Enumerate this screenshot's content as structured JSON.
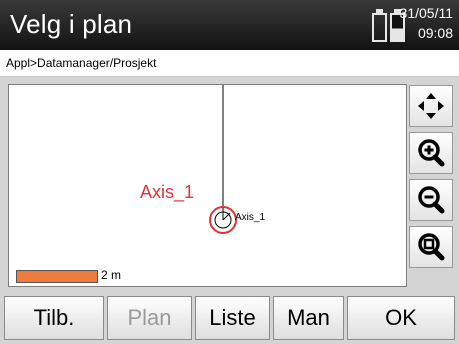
{
  "header": {
    "title": "Velg i plan",
    "date": "31/05/11",
    "time": "09:08"
  },
  "breadcrumb": "Appl>Datamanager/Prosjekt",
  "map": {
    "axis_label_large": "Axis_1",
    "axis_label_small": "Axis_1",
    "scale_label": "2 m"
  },
  "tools": {
    "pan": "pan-arrows-icon",
    "zoom_in": "zoom-in-icon",
    "zoom_out": "zoom-out-icon",
    "zoom_fit": "zoom-fit-icon"
  },
  "softkeys": {
    "back": "Tilb.",
    "plan": "Plan",
    "list": "Liste",
    "manual": "Man",
    "ok": "OK"
  },
  "colors": {
    "highlight_red": "#e63232",
    "scale_orange": "#ef7c3c",
    "title_bg": "#1e1e1e"
  }
}
